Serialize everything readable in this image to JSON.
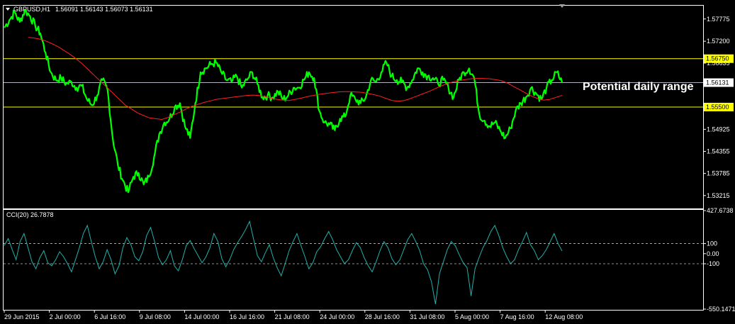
{
  "header": {
    "symbol": "GBPUSD,H1",
    "ohlc": "1.56091 1.56143 1.56073 1.56131",
    "indicator": "CCI(20) 26.7878"
  },
  "colors": {
    "background": "#000000",
    "price": "#00ff00",
    "ma": "#ff2020",
    "level_line": "#ffff00",
    "current_line": "#b0b0c0",
    "cci": "#20b2aa",
    "border": "#ffffff"
  },
  "annotation": "Potential daily range",
  "chart_data": [
    {
      "type": "line",
      "name": "price",
      "title": "GBPUSD,H1",
      "ylim": [
        1.529,
        1.581
      ],
      "y_ticks": [
        "1.57775",
        "1.57200",
        "1.56635",
        "1.56131",
        "1.55500",
        "1.54925",
        "1.54355",
        "1.53785",
        "1.53215"
      ],
      "x_ticks": [
        "29 Jun 2015",
        "2 Jul 00:00",
        "6 Jul 16:00",
        "9 Jul 08:00",
        "14 Jul 00:00",
        "16 Jul 16:00",
        "21 Jul 08:00",
        "24 Jul 00:00",
        "28 Jul 16:00",
        "31 Jul 08:00",
        "5 Aug 00:00",
        "7 Aug 16:00",
        "12 Aug 08:00"
      ],
      "levels": [
        {
          "label": "1.56750",
          "value": 1.5675,
          "kind": "upper"
        },
        {
          "label": "1.55500",
          "value": 1.555,
          "kind": "lower"
        },
        {
          "label": "1.56131",
          "value": 1.56131,
          "kind": "current"
        }
      ],
      "series": [
        {
          "name": "Close",
          "values": [
            1.5755,
            1.5775,
            1.5795,
            1.577,
            1.58,
            1.5785,
            1.576,
            1.574,
            1.569,
            1.564,
            1.562,
            1.5625,
            1.561,
            1.5615,
            1.56,
            1.5605,
            1.557,
            1.5555,
            1.558,
            1.562,
            1.5595,
            1.547,
            1.54,
            1.536,
            1.533,
            1.537,
            1.538,
            1.535,
            1.537,
            1.542,
            1.548,
            1.551,
            1.552,
            1.555,
            1.556,
            1.55,
            1.547,
            1.556,
            1.564,
            1.565,
            1.566,
            1.5665,
            1.564,
            1.562,
            1.5615,
            1.563,
            1.56,
            1.562,
            1.564,
            1.561,
            1.5575,
            1.558,
            1.5575,
            1.559,
            1.557,
            1.558,
            1.56,
            1.56,
            1.562,
            1.564,
            1.5625,
            1.554,
            1.551,
            1.5505,
            1.549,
            1.552,
            1.5525,
            1.558,
            1.557,
            1.556,
            1.5575,
            1.562,
            1.5615,
            1.564,
            1.5665,
            1.563,
            1.562,
            1.5615,
            1.56,
            1.562,
            1.565,
            1.564,
            1.563,
            1.5625,
            1.561,
            1.562,
            1.56,
            1.5575,
            1.562,
            1.564,
            1.565,
            1.5625,
            1.553,
            1.5515,
            1.55,
            1.551,
            1.549,
            1.547,
            1.5495,
            1.554,
            1.556,
            1.5575,
            1.56,
            1.5585,
            1.557,
            1.56,
            1.562,
            1.564,
            1.5613
          ]
        },
        {
          "name": "MA",
          "values": [
            1.573,
            1.5728,
            1.5725,
            1.572,
            1.5713,
            1.5705,
            1.5695,
            1.5685,
            1.5673,
            1.566,
            1.5645,
            1.563,
            1.5615,
            1.56,
            1.5585,
            1.557,
            1.5555,
            1.5545,
            1.5535,
            1.5528,
            1.5522,
            1.552,
            1.5518,
            1.5523,
            1.553,
            1.5537,
            1.5545,
            1.5552,
            1.5557,
            1.5562,
            1.5566,
            1.557,
            1.5572,
            1.5574,
            1.5576,
            1.5578,
            1.558,
            1.5581,
            1.558,
            1.5577,
            1.5573,
            1.557,
            1.5568,
            1.5567,
            1.557,
            1.5573,
            1.5577,
            1.558,
            1.5583,
            1.5585,
            1.5587,
            1.5589,
            1.559,
            1.559,
            1.5589,
            1.5588,
            1.5585,
            1.5582,
            1.5578,
            1.5572,
            1.5567,
            1.5565,
            1.5567,
            1.5572,
            1.5578,
            1.5584,
            1.559,
            1.5597,
            1.5604,
            1.561,
            1.5615,
            1.5618,
            1.5621,
            1.5623,
            1.5624,
            1.5624,
            1.5623,
            1.5621,
            1.5618,
            1.5612,
            1.5603,
            1.5595,
            1.5586,
            1.5578,
            1.5572,
            1.5568,
            1.557,
            1.5575,
            1.558
          ]
        }
      ]
    },
    {
      "type": "line",
      "name": "cci",
      "title": "CCI(20) 26.7878",
      "ylim": [
        -550.1471,
        427.6738
      ],
      "y_ticks": [
        "427.6738",
        "100",
        "0.00",
        "-100",
        "-550.1471"
      ],
      "reference_lines": [
        100,
        -100
      ],
      "series": [
        {
          "name": "CCI(20)",
          "values": [
            80,
            150,
            40,
            -60,
            120,
            200,
            60,
            -80,
            -150,
            -40,
            30,
            -90,
            -120,
            -60,
            20,
            -30,
            -100,
            -180,
            -60,
            60,
            200,
            280,
            120,
            -30,
            -150,
            -80,
            40,
            -60,
            -200,
            -120,
            60,
            160,
            90,
            -30,
            -70,
            20,
            180,
            260,
            120,
            -40,
            -110,
            -60,
            30,
            -120,
            -170,
            -60,
            80,
            130,
            50,
            -20,
            -90,
            -30,
            60,
            200,
            120,
            -50,
            -130,
            -60,
            40,
            110,
            170,
            240,
            320,
            150,
            -20,
            -80,
            10,
            90,
            -40,
            -140,
            -220,
            -100,
            30,
            120,
            200,
            80,
            -30,
            -150,
            -90,
            20,
            70,
            150,
            220,
            140,
            40,
            -30,
            -100,
            -60,
            30,
            110,
            60,
            -40,
            -120,
            -180,
            -80,
            30,
            120,
            60,
            -50,
            -110,
            -60,
            40,
            140,
            200,
            120,
            30,
            -100,
            -160,
            -280,
            -500,
            -200,
            -80,
            40,
            120,
            80,
            -10,
            -90,
            -140,
            -420,
            -150,
            -40,
            60,
            130,
            220,
            280,
            180,
            60,
            -30,
            -100,
            -60,
            40,
            120,
            210,
            90,
            30,
            -60,
            -20,
            40,
            120,
            200,
            100,
            27
          ]
        }
      ]
    }
  ]
}
